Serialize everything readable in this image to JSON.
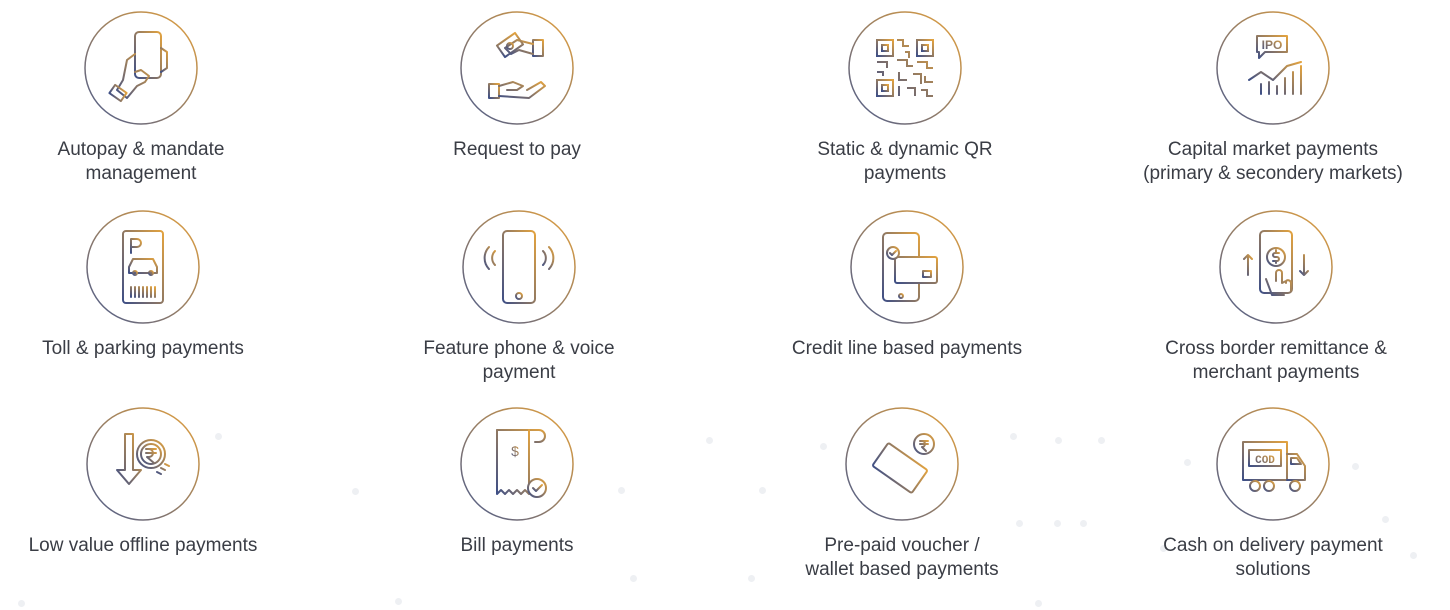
{
  "colors": {
    "ring_start": "#e6a23c",
    "ring_end": "#4a5b8c",
    "icon_start": "#e3a33f",
    "icon_end": "#3e4f86",
    "text": "#3a3d45"
  },
  "items": [
    {
      "icon": "hand-holding-phone-icon",
      "lines": [
        "Autopay & mandate",
        "management"
      ]
    },
    {
      "icon": "request-money-hands-icon",
      "lines": [
        "Request to pay"
      ]
    },
    {
      "icon": "qr-code-icon",
      "lines": [
        "Static & dynamic QR",
        "payments"
      ]
    },
    {
      "icon": "ipo-chart-icon",
      "lines": [
        "Capital market payments",
        "(primary & secondery markets)"
      ]
    },
    {
      "icon": "parking-ticket-icon",
      "lines": [
        "Toll & parking payments"
      ]
    },
    {
      "icon": "feature-phone-icon",
      "lines": [
        "Feature phone & voice",
        "payment"
      ]
    },
    {
      "icon": "phone-card-icon",
      "lines": [
        "Credit line based payments"
      ]
    },
    {
      "icon": "phone-dollar-hand-icon",
      "lines": [
        "Cross border remittance &",
        "merchant payments"
      ]
    },
    {
      "icon": "rupee-down-arrow-icon",
      "lines": [
        "Low value offline payments"
      ]
    },
    {
      "icon": "bill-receipt-icon",
      "lines": [
        "Bill payments"
      ]
    },
    {
      "icon": "voucher-rupee-icon",
      "lines": [
        "Pre-paid voucher /",
        "wallet based payments"
      ]
    },
    {
      "icon": "cod-truck-icon",
      "lines": [
        "Cash on delivery payment",
        "solutions"
      ]
    }
  ]
}
